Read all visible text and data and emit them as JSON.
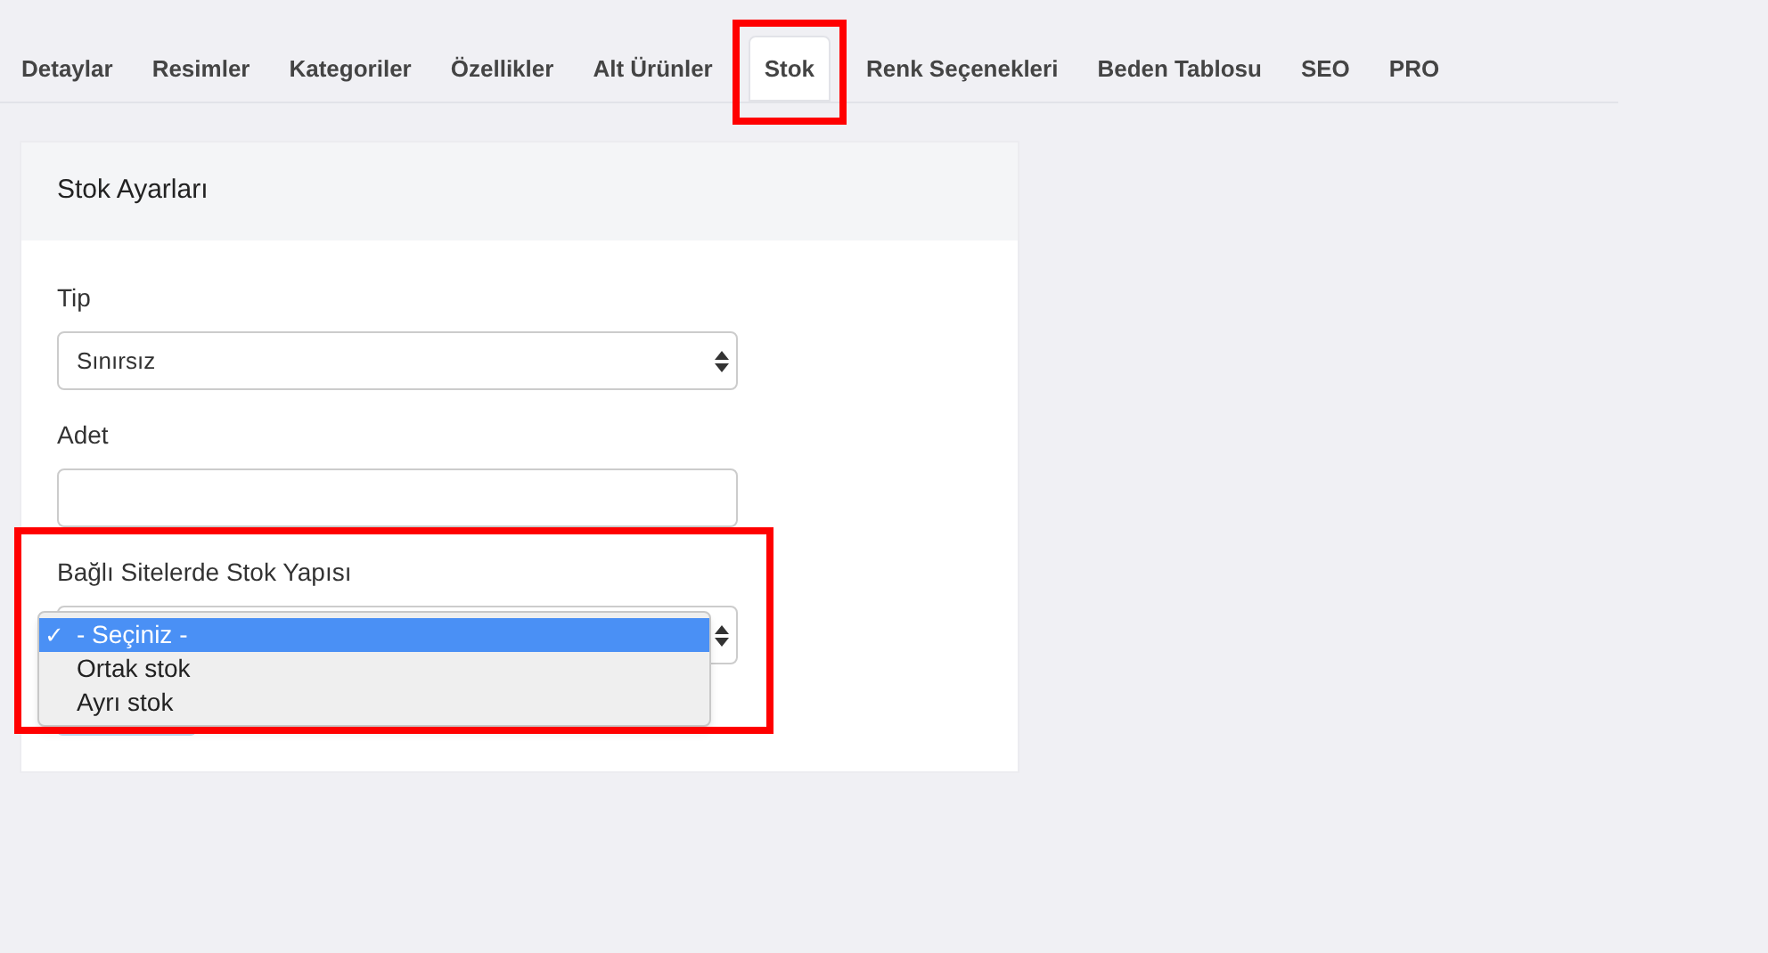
{
  "tabs": [
    {
      "label": "Detaylar",
      "selected": false
    },
    {
      "label": "Resimler",
      "selected": false
    },
    {
      "label": "Kategoriler",
      "selected": false
    },
    {
      "label": "Özellikler",
      "selected": false
    },
    {
      "label": "Alt Ürünler",
      "selected": false
    },
    {
      "label": "Stok",
      "selected": true
    },
    {
      "label": "Renk Seçenekleri",
      "selected": false
    },
    {
      "label": "Beden Tablosu",
      "selected": false
    },
    {
      "label": "SEO",
      "selected": false
    },
    {
      "label": "PRO",
      "selected": false
    }
  ],
  "card": {
    "title": "Stok Ayarları",
    "fields": [
      {
        "kind": "select",
        "label": "Tip",
        "value": "Sınırsız"
      },
      {
        "kind": "input",
        "label": "Adet"
      },
      {
        "kind": "select",
        "label": "Bağlı Sitelerde Stok Yapısı",
        "expanded": true,
        "options": [
          {
            "label": "- Seçiniz -",
            "selected": true,
            "mark": "✓"
          },
          {
            "label": "Ortak stok",
            "selected": false
          },
          {
            "label": "Ayrı stok",
            "selected": false
          }
        ]
      }
    ]
  }
}
